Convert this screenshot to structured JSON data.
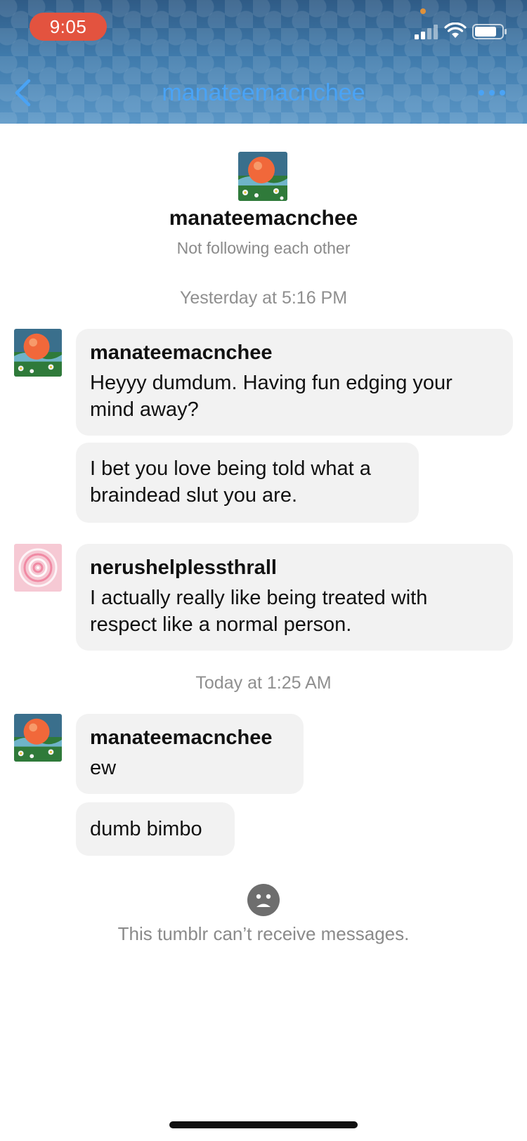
{
  "status_bar": {
    "time": "9:05"
  },
  "nav": {
    "title": "manateemacnchee",
    "back_icon": "chevron-left-icon",
    "more_icon": "ellipsis-icon",
    "accent_color": "#4aa3f5"
  },
  "profile": {
    "name": "manateemacnchee",
    "relationship": "Not following each other"
  },
  "conversation": {
    "groups": [
      {
        "timestamp": "Yesterday at 5:16 PM",
        "messages": [
          {
            "sender": "manateemacnchee",
            "bubbles": [
              "Heyyy dumdum.  Having fun edging your mind away?",
              "I bet you love being told what a braindead slut you are."
            ]
          },
          {
            "sender": "nerushelplessthrall",
            "bubbles": [
              "I actually really like being treated with respect like a normal person."
            ]
          }
        ]
      },
      {
        "timestamp": "Today at 1:25 AM",
        "messages": [
          {
            "sender": "manateemacnchee",
            "bubbles": [
              "ew",
              "dumb bimbo"
            ]
          }
        ]
      }
    ]
  },
  "footer": {
    "notice_icon": "sad-face-icon",
    "notice": "This tumblr can’t receive messages."
  }
}
